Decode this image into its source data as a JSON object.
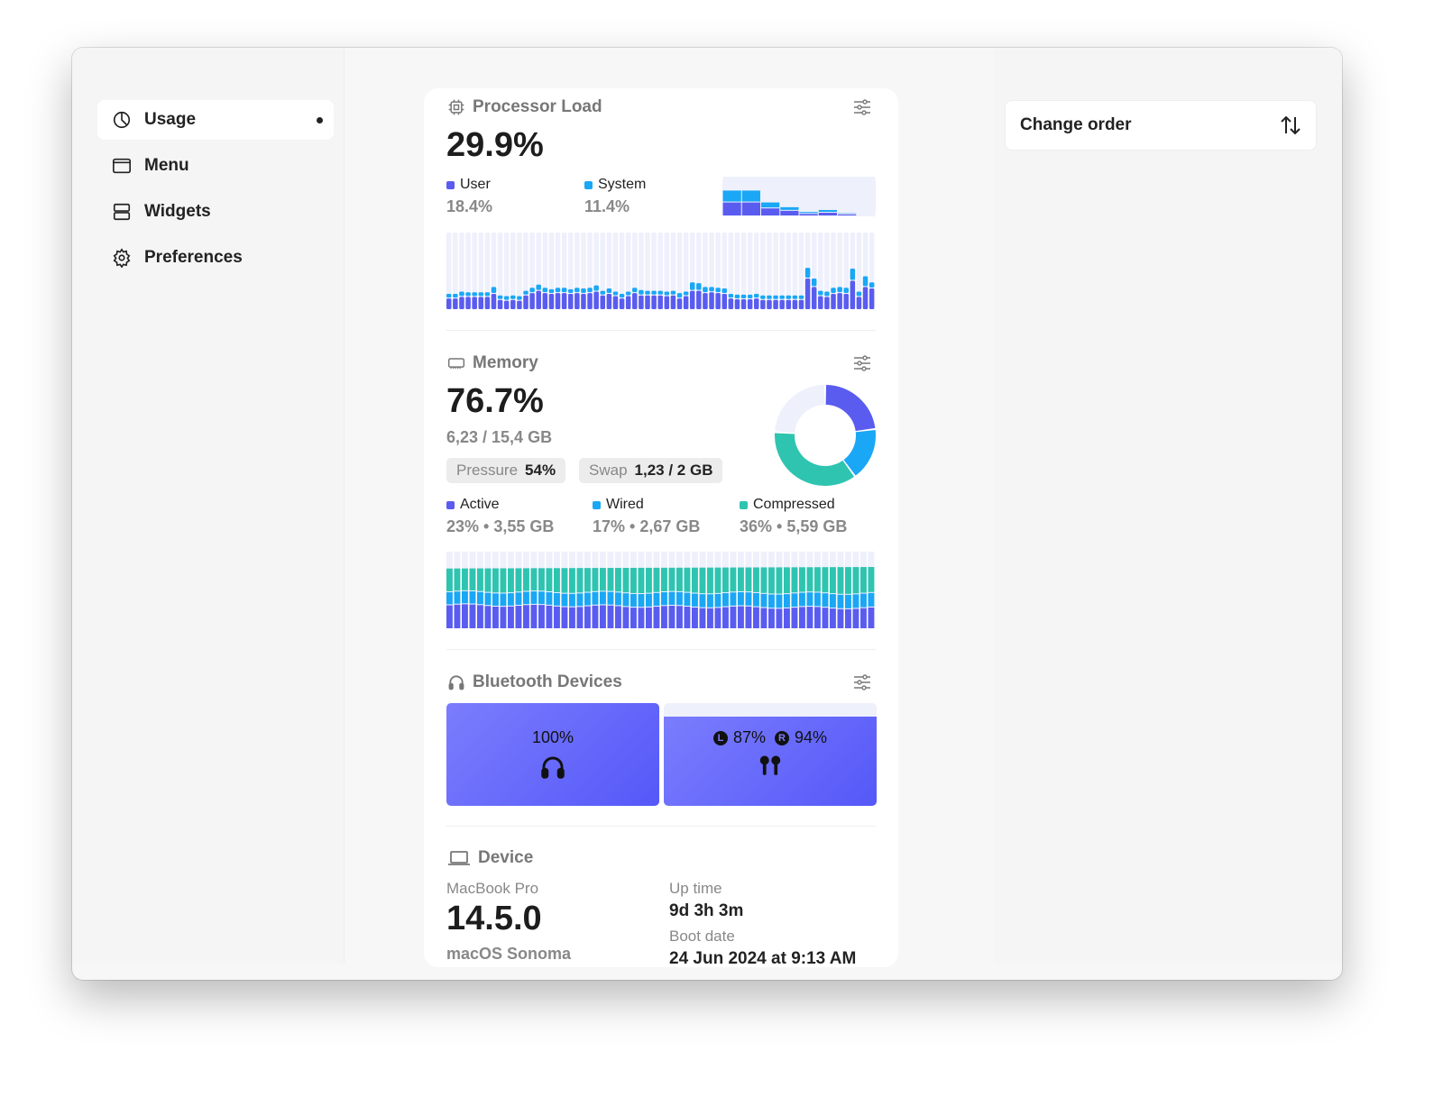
{
  "window": {
    "controls": [
      "close",
      "minimize",
      "zoom"
    ],
    "colors": {
      "close": "#fe5f57",
      "minimize": "#febc2e",
      "zoom": "#d9d9d9"
    }
  },
  "sidebar": {
    "items": [
      {
        "label": "Usage",
        "icon": "chart-pie-icon",
        "active": true
      },
      {
        "label": "Menu",
        "icon": "menu-window-icon"
      },
      {
        "label": "Widgets",
        "icon": "widgets-icon"
      },
      {
        "label": "Preferences",
        "icon": "gear-icon"
      }
    ]
  },
  "processor": {
    "title": "Processor Load",
    "total": "29.9%",
    "user_label": "User",
    "user_value": "18.4%",
    "system_label": "System",
    "system_value": "11.4%",
    "colors": {
      "user": "#5a5cf0",
      "system": "#1aa7f5",
      "track": "#eef0fc"
    },
    "cores": [
      {
        "user": 35,
        "system": 30
      },
      {
        "user": 35,
        "system": 30
      },
      {
        "user": 20,
        "system": 15
      },
      {
        "user": 14,
        "system": 9
      },
      {
        "user": 6,
        "system": 5
      },
      {
        "user": 9,
        "system": 7
      },
      {
        "user": 5,
        "system": 3
      },
      {
        "user": 2,
        "system": 2
      }
    ],
    "history_user": [
      14,
      14,
      16,
      16,
      16,
      16,
      16,
      20,
      12,
      11,
      12,
      11,
      18,
      21,
      24,
      21,
      20,
      21,
      21,
      20,
      21,
      20,
      21,
      23,
      18,
      20,
      17,
      14,
      17,
      21,
      18,
      18,
      18,
      18,
      17,
      18,
      14,
      17,
      24,
      24,
      21,
      22,
      21,
      20,
      14,
      13,
      13,
      13,
      14,
      12,
      12,
      12,
      12,
      12,
      12,
      12,
      40,
      29,
      17,
      16,
      20,
      21,
      20,
      37,
      16,
      29,
      27
    ],
    "history_system": [
      6,
      6,
      7,
      6,
      6,
      6,
      6,
      9,
      6,
      6,
      6,
      6,
      6,
      7,
      8,
      7,
      6,
      7,
      7,
      6,
      7,
      7,
      7,
      8,
      6,
      7,
      6,
      6,
      6,
      7,
      7,
      6,
      6,
      6,
      6,
      6,
      7,
      6,
      11,
      10,
      8,
      7,
      7,
      7,
      6,
      6,
      6,
      6,
      6,
      6,
      6,
      6,
      6,
      6,
      6,
      6,
      14,
      11,
      7,
      7,
      8,
      8,
      8,
      16,
      7,
      14,
      8
    ]
  },
  "memory": {
    "title": "Memory",
    "total": "76.7%",
    "used": "6,23 / 15,4 GB",
    "pressure_label": "Pressure",
    "pressure_value": "54%",
    "swap_label": "Swap",
    "swap_value": "1,23 / 2 GB",
    "legend": [
      {
        "label": "Active",
        "value": "23% • 3,55 GB",
        "pct": 23,
        "color": "#5a5cf0"
      },
      {
        "label": "Wired",
        "value": "17% • 2,67 GB",
        "pct": 17,
        "color": "#1aa7f5"
      },
      {
        "label": "Compressed",
        "value": "36% • 5,59 GB",
        "pct": 36,
        "color": "#2ec4b0"
      }
    ],
    "track_color": "#eef0fc"
  },
  "bluetooth": {
    "title": "Bluetooth Devices",
    "devices": [
      {
        "label": "100%",
        "icon": "headphones-icon",
        "level": 100
      },
      {
        "left": "87%",
        "right": "94%",
        "left_badge": "L",
        "right_badge": "R",
        "icon": "airpods-icon",
        "level": 87
      }
    ]
  },
  "device": {
    "title": "Device",
    "model": "MacBook Pro",
    "version": "14.5.0",
    "os": "macOS Sonoma",
    "uptime_label": "Up time",
    "uptime": "9d 3h 3m",
    "boot_label": "Boot date",
    "boot": "24 Jun 2024 at 9:13 AM"
  },
  "right": {
    "change_order": "Change order"
  }
}
